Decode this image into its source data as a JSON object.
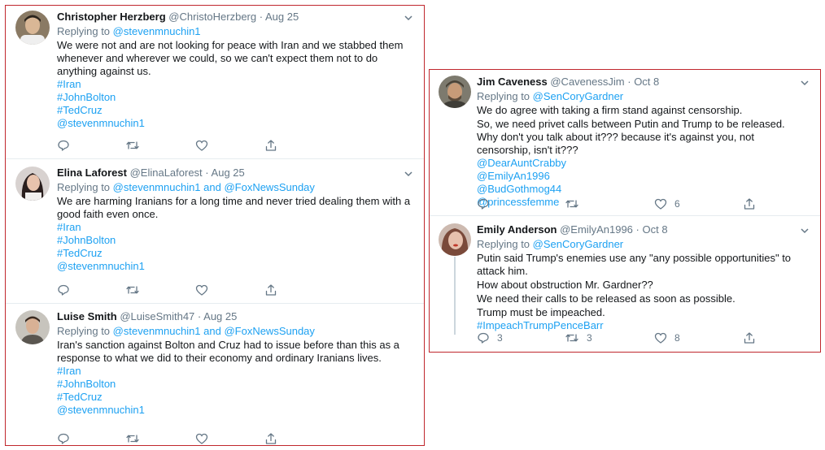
{
  "colors": {
    "frame": "#c0272d",
    "link": "#1da1f2",
    "muted": "#657786",
    "text": "#14171a"
  },
  "left_tweets": [
    {
      "name": "Christopher Herzberg",
      "handle": "@ChristoHerzberg",
      "sep": "·",
      "date": "Aug 25",
      "replying_prefix": "Replying to",
      "replying_to": "@stevenmnuchin1",
      "text": "We were not and are not looking for peace with Iran and we stabbed them whenever and wherever we could, so we can't expect them not to do anything against us.",
      "tags": [
        "#Iran",
        "#JohnBolton",
        "#TedCruz",
        "@stevenmnuchin1"
      ]
    },
    {
      "name": "Elina Laforest",
      "handle": "@ElinaLaforest",
      "sep": "·",
      "date": "Aug 25",
      "replying_prefix": "Replying to",
      "replying_to": "@stevenmnuchin1 and @FoxNewsSunday",
      "text": "We are harming Iranians for a long time and never tried dealing them with a good faith even once.",
      "tags": [
        "#Iran",
        "#JohnBolton",
        "#TedCruz",
        "@stevenmnuchin1"
      ]
    },
    {
      "name": "Luise Smith",
      "handle": "@LuiseSmith47",
      "sep": "·",
      "date": "Aug 25",
      "replying_prefix": "Replying to",
      "replying_to": "@stevenmnuchin1 and @FoxNewsSunday",
      "text": "Iran's sanction against Bolton and Cruz had to issue before than this as a response to what we did to their economy and ordinary Iranians lives.",
      "tags": [
        "#Iran",
        "#JohnBolton",
        "#TedCruz",
        "@stevenmnuchin1"
      ]
    }
  ],
  "right_tweets": [
    {
      "name": "Jim Caveness",
      "handle": "@CavenessJim",
      "sep": "·",
      "date": "Oct 8",
      "replying_prefix": "Replying to",
      "replying_to": "@SenCoryGardner",
      "text": "We do agree with taking a firm stand against censorship.",
      "text2": "So, we need privet calls between Putin and Trump to be released. Why don't you talk about it??? because it's against you, not censorship, isn't it???",
      "tags": [
        "@DearAuntCrabby",
        "@EmilyAn1996",
        "@BudGothmog44",
        "@princessfemme"
      ],
      "like_count": "6"
    },
    {
      "name": "Emily Anderson",
      "handle": "@EmilyAn1996",
      "sep": "·",
      "date": "Oct 8",
      "replying_prefix": "Replying to",
      "replying_to": "@SenCoryGardner",
      "text": "Putin said Trump's enemies use any \"any possible opportunities\" to attack him.",
      "line2": "How about obstruction Mr. Gardner??",
      "line3": "We need their calls to be released as soon as possible.",
      "line4": "Trump must be impeached.",
      "tags": [
        "#ImpeachTrumpPenceBarr"
      ],
      "reply_count": "3",
      "retweet_count": "3",
      "like_count": "8"
    }
  ]
}
